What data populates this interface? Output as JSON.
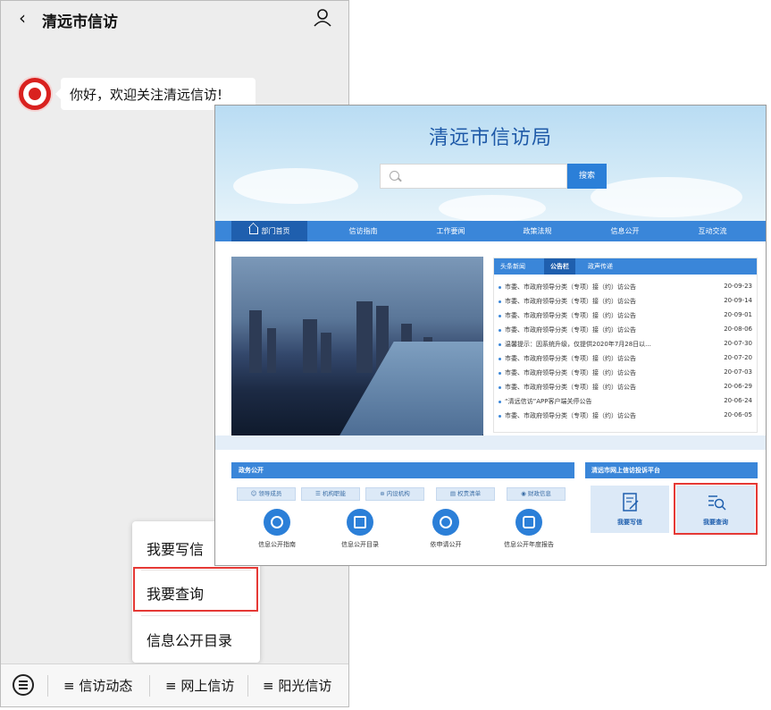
{
  "phone": {
    "title": "清远市信访",
    "back_icon": "chevron-left-icon",
    "user_icon": "user-icon",
    "message": "你好，欢迎关注清远信访!",
    "popup_items": [
      "我要写信",
      "我要查询",
      "信息公开目录"
    ],
    "highlighted_item": "我要查询",
    "bottom_menu": [
      "≡ 信访动态",
      "≡ 网上信访",
      "≡ 阳光信访"
    ],
    "keyboard_icon": "keyboard-icon"
  },
  "site": {
    "title": "清远市信访局",
    "search_placeholder": "",
    "search_button": "搜索",
    "nav": [
      "部门首页",
      "信访指南",
      "工作要闻",
      "政策法规",
      "信息公开",
      "互动交流"
    ],
    "news_tabs": [
      "头条新闻",
      "公告栏",
      "政声传递"
    ],
    "active_news_tab": "公告栏",
    "news": [
      {
        "title": "市委、市政府领导分类（专项）接（约）访公告",
        "date": "20-09-23"
      },
      {
        "title": "市委、市政府领导分类（专项）接（约）访公告",
        "date": "20-09-14"
      },
      {
        "title": "市委、市政府领导分类（专项）接（约）访公告",
        "date": "20-09-01"
      },
      {
        "title": "市委、市政府领导分类（专项）接（约）访公告",
        "date": "20-08-06"
      },
      {
        "title": "温馨提示：因系统升级，仅提供2020年7月28日以...",
        "date": "20-07-30"
      },
      {
        "title": "市委、市政府领导分类（专项）接（约）访公告",
        "date": "20-07-20"
      },
      {
        "title": "市委、市政府领导分类（专项）接（约）访公告",
        "date": "20-07-03"
      },
      {
        "title": "市委、市政府领导分类（专项）接（约）访公告",
        "date": "20-06-29"
      },
      {
        "title": "“清远信访”APP客户端关停公告",
        "date": "20-06-24"
      },
      {
        "title": "市委、市政府领导分类（专项）接（约）访公告",
        "date": "20-06-05"
      }
    ],
    "gov_title": "政务公开",
    "gov_buttons": [
      "领导成员",
      "机构职能",
      "内设机构",
      "权责清单",
      "财政信息"
    ],
    "gov_links": [
      "信息公开指南",
      "信息公开目录",
      "依申请公开",
      "信息公开年度报告"
    ],
    "platform_title": "清远市网上信访投诉平台",
    "platform_cards": [
      "我要写信",
      "我要查询"
    ]
  },
  "colors": {
    "nav_blue": "#3a86d9",
    "dark_blue": "#1f5fae",
    "highlight_red": "#e53935"
  }
}
